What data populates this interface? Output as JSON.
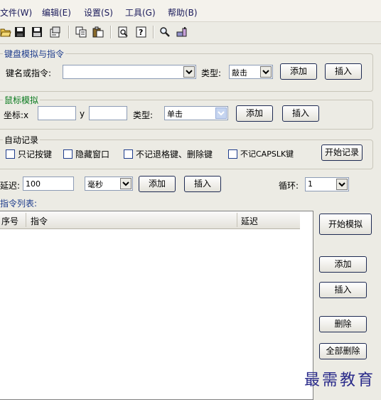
{
  "menu": {
    "items": [
      "文件(W)",
      "编辑(E)",
      "设置(S)",
      "工具(G)",
      "帮助(B)"
    ]
  },
  "toolbar": {
    "icons": [
      "open-folder-icon",
      "save-icon",
      "save-as-icon",
      "properties-icon",
      "copy-icon",
      "paste-icon",
      "print-preview-icon",
      "help-icon",
      "find-icon",
      "tool-icon"
    ]
  },
  "keyboard": {
    "group_label": "键盘模拟与指令",
    "key_label": "键名或指令:",
    "key_value": "",
    "type_label": "类型:",
    "type_value": "敲击",
    "add_label": "添加",
    "insert_label": "插入"
  },
  "mouse": {
    "group_label": "鼠标模拟",
    "coord_label": "坐标:x",
    "y_label": "y",
    "x_value": "",
    "y_value": "",
    "type_label": "类型:",
    "type_value": "单击",
    "add_label": "添加",
    "insert_label": "插入"
  },
  "record": {
    "group_label": "自动记录",
    "options": [
      "只记按键",
      "隐藏窗口",
      "不记退格键、删除键",
      "不记CAPSLK键"
    ],
    "start_label": "开始记录"
  },
  "delay": {
    "label": "延迟:",
    "value": "100",
    "unit": "毫秒",
    "add_label": "添加",
    "insert_label": "插入",
    "loop_label": "循环:",
    "loop_value": "1"
  },
  "list": {
    "title": "指令列表:",
    "columns": [
      "序号",
      "指令",
      "延迟"
    ]
  },
  "side": {
    "start_sim": "开始模拟",
    "add": "添加",
    "insert": "插入",
    "delete": "删除",
    "delete_all": "全部删除"
  },
  "watermark": "最需教育",
  "colors": {
    "background": "#ecebe4",
    "group_title": "#1e3c8c",
    "mouse_title": "#0a7a1e"
  }
}
